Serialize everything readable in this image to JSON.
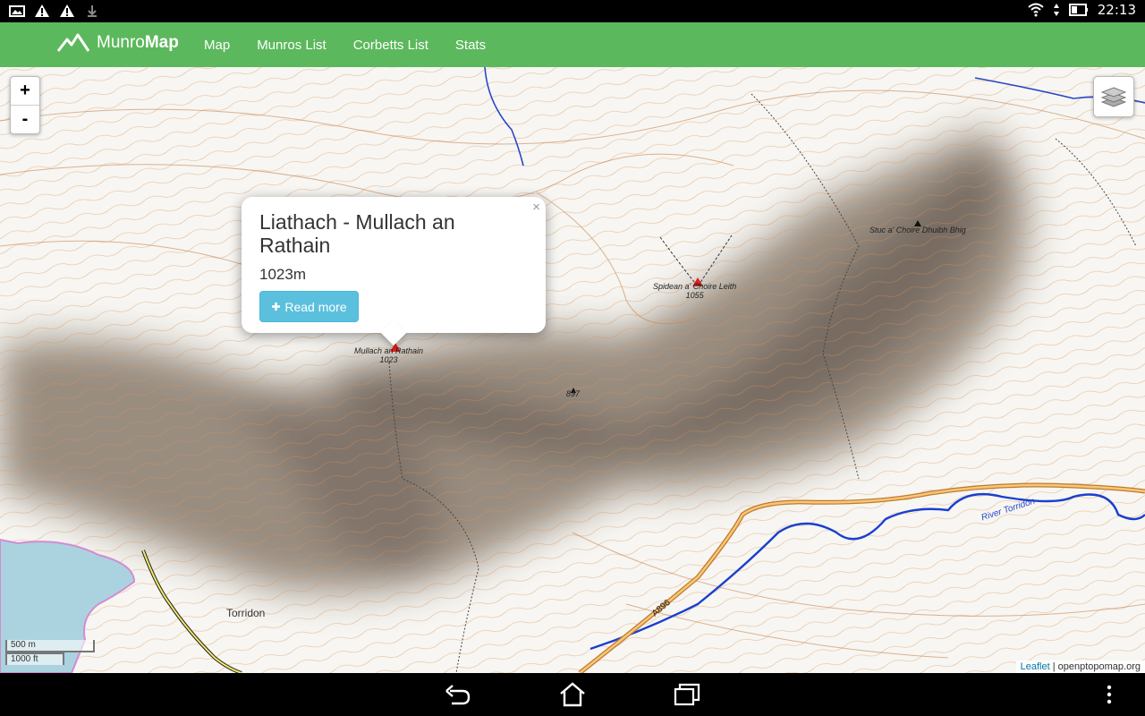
{
  "status_bar": {
    "time": "22:13",
    "icons": [
      "image-icon",
      "warning-icon",
      "warning-icon",
      "download-icon",
      "wifi-icon",
      "signal-arrows-icon",
      "battery-icon"
    ]
  },
  "navbar": {
    "brand_prefix": "Munro",
    "brand_bold": "Map",
    "links": [
      "Map",
      "Munros List",
      "Corbetts List",
      "Stats"
    ],
    "color": "#5cb85c"
  },
  "map": {
    "zoom_in": "+",
    "zoom_out": "-",
    "popup": {
      "title": "Liathach - Mullach an Rathain",
      "height": "1023m",
      "button": "Read more",
      "close": "×",
      "button_color": "#5bc0de"
    },
    "peaks": [
      {
        "name": "Mullach an Rathain",
        "height": "1023"
      },
      {
        "name": "Spidean a' Choire Leith",
        "height": "1055"
      },
      {
        "name": "Stuc a' Choire Dhuibh Bhig",
        "height": ""
      },
      {
        "name": "",
        "height": "897"
      }
    ],
    "place_labels": [
      "Torridon",
      "River Torridon",
      "A896"
    ],
    "scale": {
      "metric": "500 m",
      "imperial": "1000 ft"
    },
    "attribution": {
      "link": "Leaflet",
      "separator": "|",
      "source": "openptopomap.org"
    }
  },
  "system_nav": [
    "back-icon",
    "home-icon",
    "recent-apps-icon",
    "overflow-menu-icon"
  ]
}
